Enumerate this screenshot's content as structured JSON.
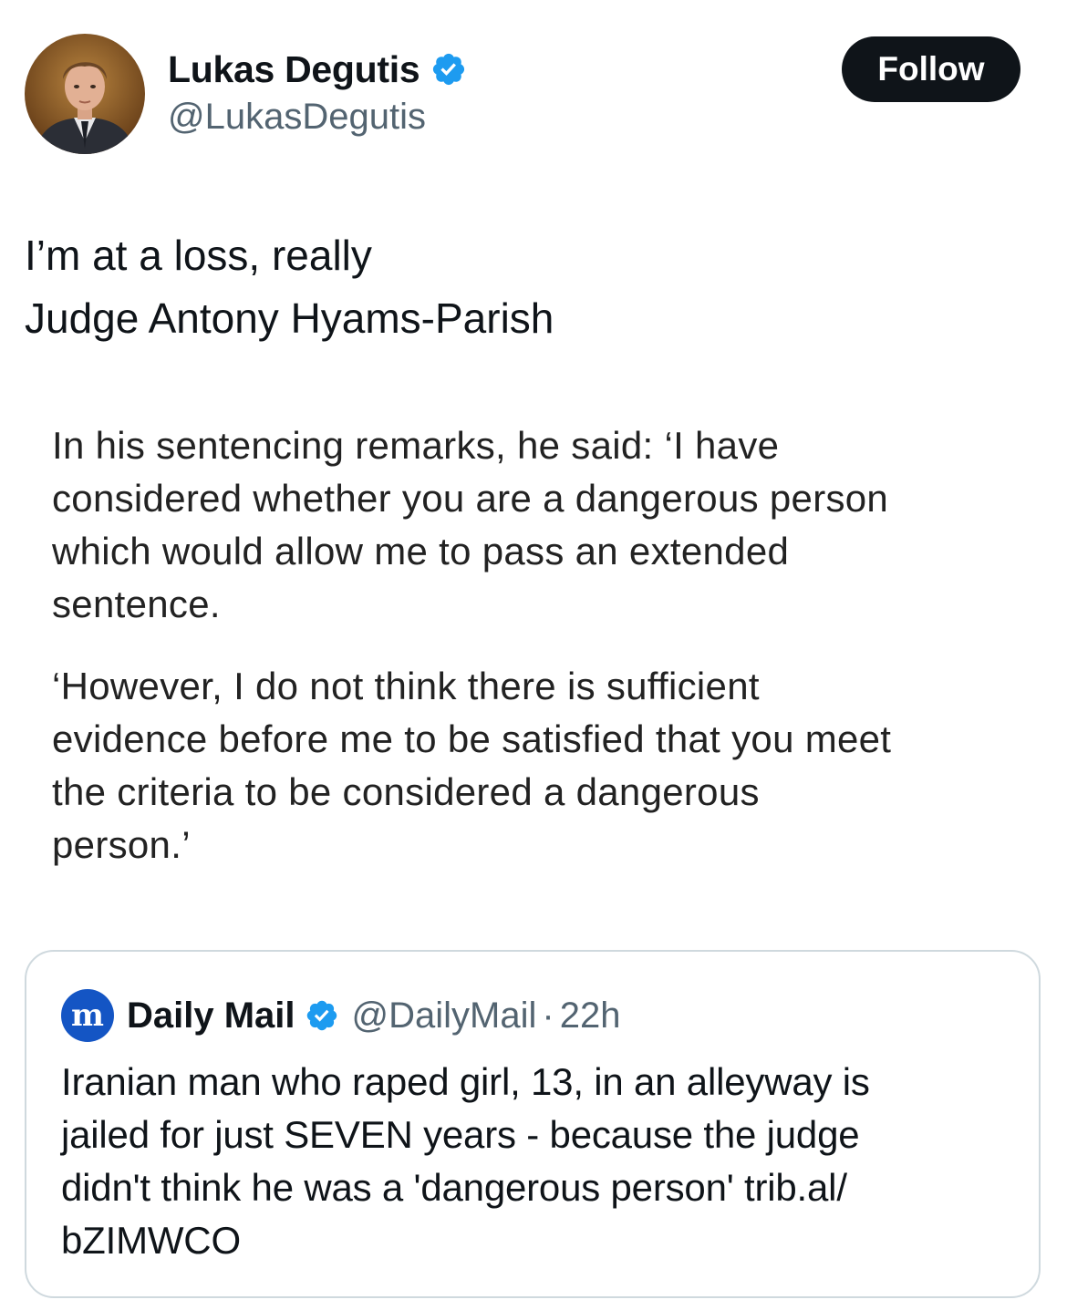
{
  "author": {
    "display_name": "Lukas Degutis",
    "handle": "@LukasDegutis",
    "avatar_icon": "profile-photo"
  },
  "follow_button_label": "Follow",
  "tweet_text_lines": [
    "I’m at a loss, really",
    "Judge Antony Hyams-Parish"
  ],
  "media": {
    "paragraph1_lines": [
      "In his sentencing remarks, he said: ‘I have",
      "considered whether you are a dangerous person",
      "which would allow me to pass an extended",
      "sentence."
    ],
    "paragraph2_lines": [
      "‘However, I do not think there is sufficient",
      "evidence before me to be satisfied that you meet",
      "the criteria to be considered a dangerous",
      "person.’"
    ]
  },
  "quote": {
    "logo_letter": "m",
    "display_name": "Daily Mail",
    "handle": "@DailyMail",
    "separator": "·",
    "time": "22h",
    "text_lines": [
      "Iranian man who raped girl, 13, in an alleyway is",
      "jailed for just SEVEN years - because the judge",
      "didn't think he was a 'dangerous person' trib.al/",
      "bZIMWCO"
    ]
  },
  "colors": {
    "verified_blue": "#1d9bf0",
    "follow_button_bg": "#0f1419",
    "secondary_text": "#536471",
    "quote_border": "#cfd9de",
    "daily_mail_blue": "#1455c4"
  }
}
